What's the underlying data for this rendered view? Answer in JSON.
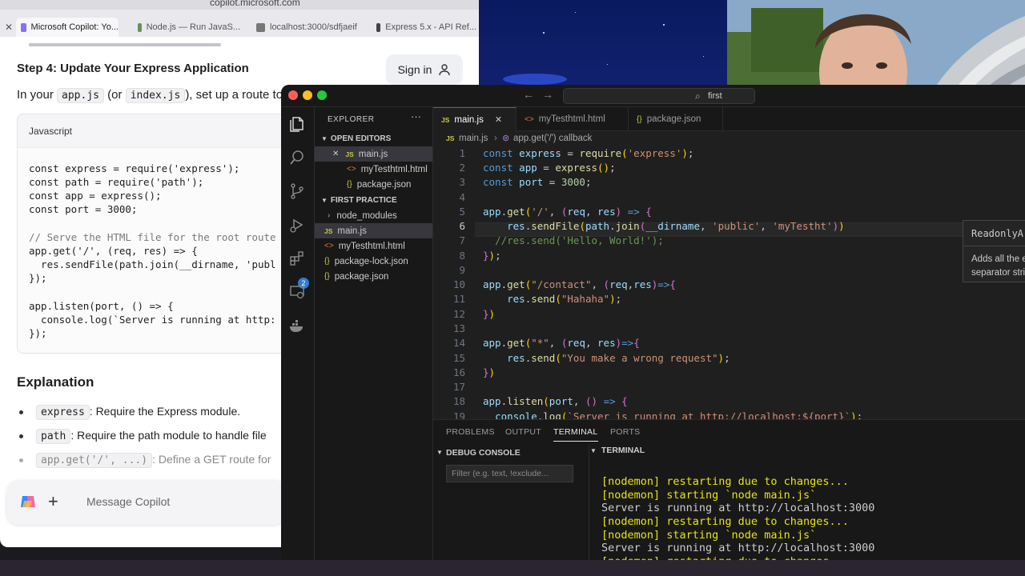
{
  "browser": {
    "url": "copilot.microsoft.com",
    "tabs": [
      {
        "label": "Microsoft Copilot: Yo...",
        "active": true
      },
      {
        "label": "Node.js — Run JavaS..."
      },
      {
        "label": "localhost:3000/sdfjaeif"
      },
      {
        "label": "Express 5.x - API Ref..."
      }
    ]
  },
  "copilot": {
    "step_title": "Step 4: Update Your Express Application",
    "sign_in": "Sign in",
    "para_prefix": "In your",
    "para_file1": "app.js",
    "para_mid": "(or",
    "para_file2": "index.js",
    "para_suffix": "), set up a route to",
    "code_lang": "Javascript",
    "code_lines": [
      "const express = require('express');",
      "const path = require('path');",
      "const app = express();",
      "const port = 3000;",
      "",
      "// Serve the HTML file for the root route",
      "app.get('/', (req, res) => {",
      "  res.sendFile(path.join(__dirname, 'publ",
      "});",
      "",
      "app.listen(port, () => {",
      "  console.log(`Server is running at http:",
      "});"
    ],
    "explanation_title": "Explanation",
    "bullets": [
      {
        "code": "express",
        "text": ": Require the Express module."
      },
      {
        "code": "path",
        "text": ": Require the path module to handle file"
      },
      {
        "code": "app.get('/', ...)",
        "text": ": Define a GET route for"
      }
    ],
    "message_placeholder": "Message Copilot"
  },
  "vscode": {
    "command_center": "first",
    "explorer_title": "EXPLORER",
    "open_editors_title": "OPEN EDITORS",
    "open_editors": [
      "main.js",
      "myTesthtml.html",
      "package.json"
    ],
    "project_title": "FIRST PRACTICE",
    "project_files": [
      "node_modules",
      "main.js",
      "myTesthtml.html",
      "package-lock.json",
      "package.json"
    ],
    "scm_badge": "2",
    "editor_tabs": [
      "main.js",
      "myTesthtml.html",
      "package.json"
    ],
    "breadcrumb_file": "main.js",
    "breadcrumb_symbol": "app.get('/') callback",
    "line_numbers": [
      "1",
      "2",
      "3",
      "4",
      "5",
      "6",
      "7",
      "8",
      "9",
      "10",
      "11",
      "12",
      "13",
      "14",
      "15",
      "16",
      "17",
      "18",
      "19"
    ],
    "hover_signature": "ReadonlyArray.join(separator?: stri",
    "hover_description": "Adds all the elements of an array separated by separator string.",
    "panel_tabs": [
      "PROBLEMS",
      "OUTPUT",
      "TERMINAL",
      "PORTS"
    ],
    "active_panel_tab": "TERMINAL",
    "debug_console_title": "DEBUG CONSOLE",
    "filter_placeholder": "Filter (e.g. text, !exclude...",
    "terminal_title": "TERMINAL",
    "terminal_lines": [
      "[nodemon] restarting due to changes...",
      "[nodemon] starting `node main.js`",
      "Server is running at http://localhost:3000",
      "[nodemon] restarting due to changes...",
      "[nodemon] starting `node main.js`",
      "Server is running at http://localhost:3000",
      "[nodemon] restarting due to changes..."
    ]
  },
  "colors": {
    "vscode_accent": "#0078d4",
    "js_icon": "#cbcb41",
    "html_icon": "#e37933",
    "terminal_text": "#e5e510"
  }
}
